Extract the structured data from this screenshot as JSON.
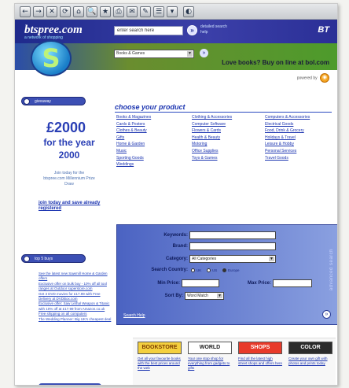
{
  "toolbar": {
    "buttons": [
      "←",
      "→",
      "✕",
      "⟳",
      "⌂",
      "🔍",
      "★",
      "⎙",
      "✉",
      "✎",
      "☰",
      "▾",
      "◐"
    ]
  },
  "header": {
    "site_title": "btspree.com",
    "tagline": "a network of shopping",
    "search_placeholder": "enter search here",
    "advanced_search": "detailed search",
    "help": "help",
    "brand": "BT"
  },
  "banner": {
    "logo_letter": "S",
    "category_select": "Books & Games",
    "promo_text": "Love books? Buy on line at bol.com",
    "sponsor_text": "powered by"
  },
  "left": {
    "giveaway_pill": "giveaway",
    "amount": "£2000",
    "for_the_year": "for the year",
    "year": "2000",
    "join_text": "Join today for the btspree.com Millennium Prize Draw",
    "join_link": "join today and save already registered",
    "top_buys_pill": "top 5 buys",
    "top_buys": [
      "See the latest new Sawmill Home & Garden offers",
      "Exclusive offer on bulk buy - 10% off all tool ranges at Outdoor superstore.com",
      "Get 3 DVD movies for £17.99 with Free Delivery at DVDBox.com",
      "Exclusive offer: Saw Lethal Weapon & Titanic with 10% off at £17.99 from Amazon.co.uk",
      "Free shipping on all computers",
      "The Wedding Planner: Big UK's cheapest deal"
    ],
    "bottom_pill": ""
  },
  "products": {
    "title": "choose your product",
    "col1": [
      "Books & Magazines",
      "Cards & Posters",
      "Clothes & Beauty",
      "Gifts",
      "Home & Garden",
      "Music",
      "Sporting Goods",
      "Weddings"
    ],
    "col2": [
      "Clothing & Accessories",
      "Computer Software",
      "Flowers & Cards",
      "Health & Beauty",
      "Motoring",
      "Office Supplies",
      "Toys & Games"
    ],
    "col3": [
      "Computers & Accessories",
      "Electrical Goods",
      "Food, Drink & Grocery",
      "Holidays & Travel",
      "Leisure & Hobby",
      "Personal Services",
      "Travel Goods"
    ]
  },
  "search_panel": {
    "keywords_label": "Keywords:",
    "brand_label": "Brand:",
    "category_label": "Category:",
    "category_value": "All Categories",
    "country_label": "Search Country:",
    "country_options": [
      "UK",
      "US",
      "Europe"
    ],
    "min_price_label": "Min Price:",
    "max_price_label": "Max Price:",
    "sort_label": "Sort By:",
    "sort_value": "Word Match",
    "help_link": "Search Help",
    "side_label": "advanced search"
  },
  "promos": [
    {
      "title": "BOOKSTORE",
      "desc": "Get all your favourite books with the best prices around the web"
    },
    {
      "title": "WORLD",
      "desc": "Your one stop shop for everything from gadgets to gifts"
    },
    {
      "title": "SHOPS",
      "desc": "Find all the latest high street shops and offers here"
    },
    {
      "title": "COLOR",
      "desc": "Create your own gift with photos and prints today"
    }
  ]
}
